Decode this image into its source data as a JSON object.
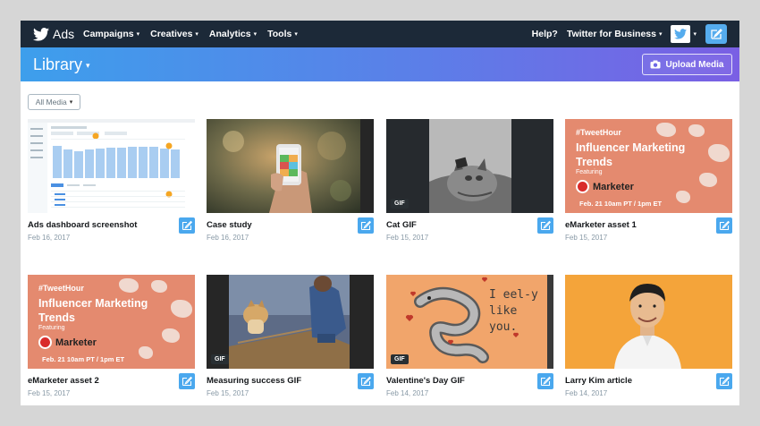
{
  "nav": {
    "brand": "Ads",
    "menu": [
      "Campaigns",
      "Creatives",
      "Analytics",
      "Tools"
    ],
    "help": "Help?",
    "business": "Twitter for Business"
  },
  "library": {
    "title": "Library",
    "upload_label": "Upload Media",
    "filter_label": "All Media"
  },
  "gif_badge": "GIF",
  "cards": [
    {
      "title": "Ads dashboard screenshot",
      "date": "Feb 16, 2017",
      "gif": false
    },
    {
      "title": "Case study",
      "date": "Feb 16, 2017",
      "gif": false
    },
    {
      "title": "Cat GIF",
      "date": "Feb 15, 2017",
      "gif": true
    },
    {
      "title": "eMarketer asset 1",
      "date": "Feb 15, 2017",
      "gif": false
    },
    {
      "title": "eMarketer asset 2",
      "date": "Feb 15, 2017",
      "gif": false
    },
    {
      "title": "Measuring success GIF",
      "date": "Feb 15, 2017",
      "gif": true
    },
    {
      "title": "Valentine's Day GIF",
      "date": "Feb 14, 2017",
      "gif": true
    },
    {
      "title": "Larry Kim article",
      "date": "Feb 14, 2017",
      "gif": false
    }
  ],
  "emarketer": {
    "hashtag": "#TweetHour",
    "headline": "Influencer Marketing Trends",
    "featuring": "Featuring",
    "brand": "Marketer",
    "when": "Feb. 21 10am PT / 1pm ET"
  },
  "valentine_text": "I eel-y like you.",
  "colors": {
    "nav_bg": "#1c2938",
    "header_start": "#3d9fec",
    "header_end": "#7a5fe4",
    "edit_button": "#4aa8ee",
    "twitter_blue": "#55acee"
  },
  "icons": {
    "brand": "twitter-bird-icon",
    "account": "twitter-bird-icon",
    "compose": "compose-icon",
    "upload": "camera-icon",
    "edit": "edit-pencil-icon"
  }
}
